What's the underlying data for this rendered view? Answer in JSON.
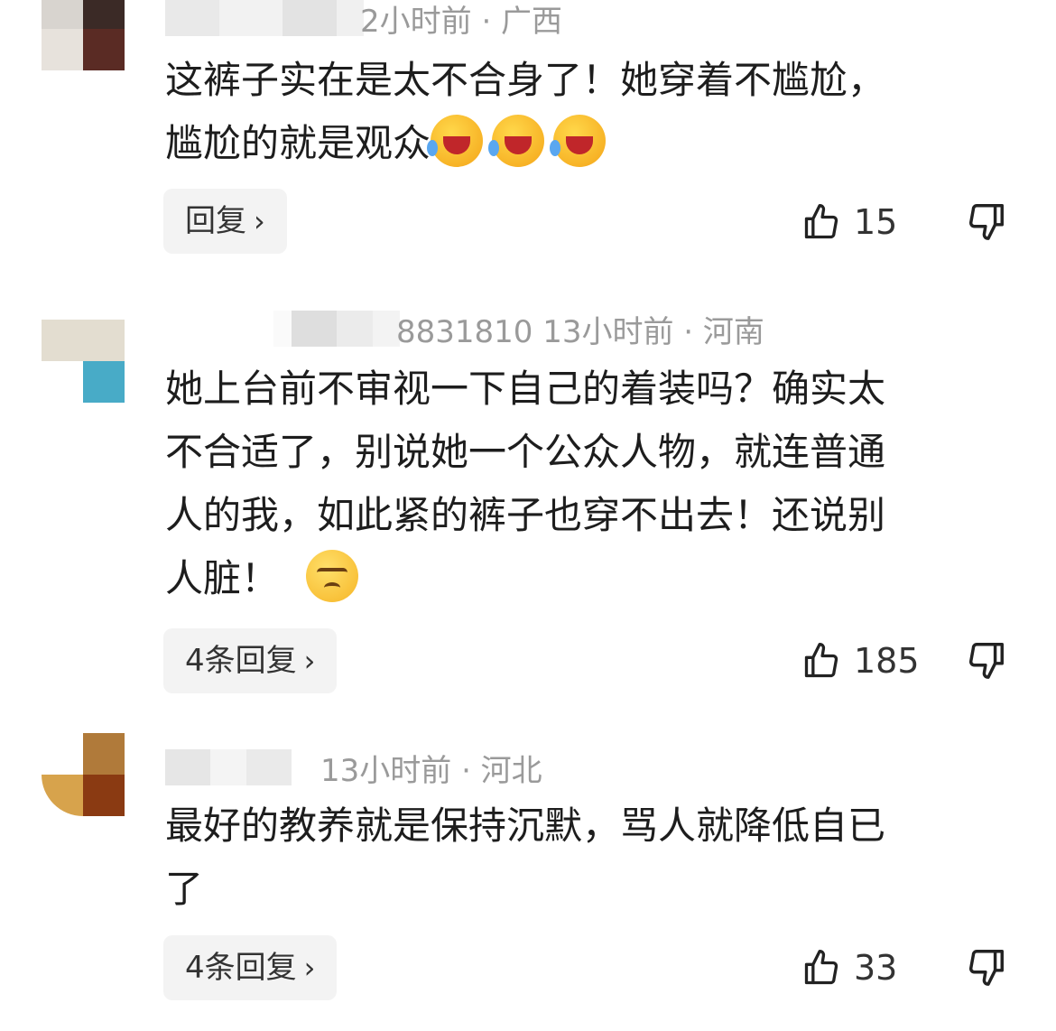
{
  "comments": [
    {
      "time": "2小时前",
      "location": "广西",
      "meta_text": "2小时前 · 广西",
      "lines": [
        "这裤子实在是太不合身了！她穿着不尴尬，",
        "尴尬的就是观众"
      ],
      "reply_label": "回复",
      "like_count": "15"
    },
    {
      "id_fragment": "8831810",
      "meta_text": "8831810  13小时前 · 河南",
      "lines": [
        "她上台前不审视一下自己的着装吗？确实太",
        "不合适了，别说她一个公众人物，就连普通",
        "人的我，如此紧的裤子也穿不出去！还说别",
        "人脏！"
      ],
      "reply_label": "4条回复",
      "like_count": "185"
    },
    {
      "meta_text": "13小时前 · 河北",
      "lines": [
        "最好的教养就是保持沉默，骂人就降低自已",
        "了"
      ],
      "reply_label": "4条回复",
      "like_count": "33"
    }
  ],
  "icons": {
    "like": "thumbs-up-icon",
    "dislike": "thumbs-down-icon",
    "chevron": "chevron-right-icon",
    "emoji_laugh": "rolling-laugh-emoji",
    "emoji_annoyed": "annoyed-face-emoji"
  },
  "colors": {
    "text": "#1d1d1d",
    "meta": "#9a9a9a",
    "button_bg": "#f3f3f3"
  }
}
